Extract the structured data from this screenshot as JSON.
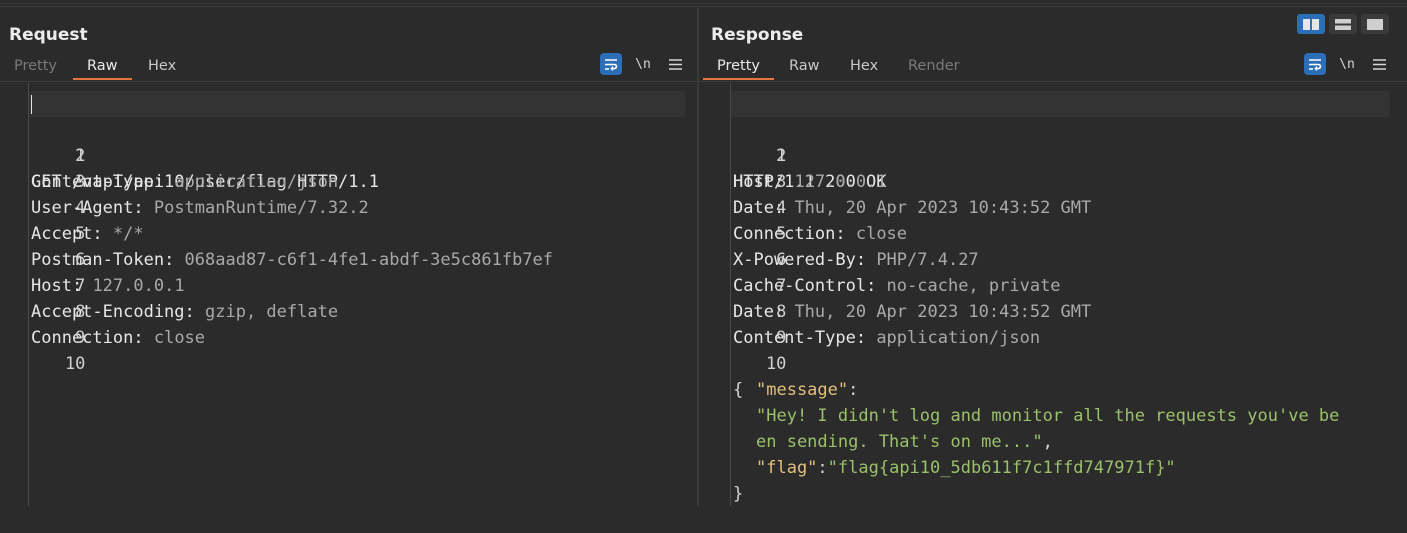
{
  "request": {
    "title": "Request",
    "tabs": [
      "Pretty",
      "Raw",
      "Hex"
    ],
    "active_tab": "Raw",
    "lines": [
      {
        "n": "1",
        "key": "GET /vapi/api10/user/flag HTTP/1.1",
        "val": ""
      },
      {
        "n": "2",
        "key": "Content-Type",
        "val": "application/json"
      },
      {
        "n": "3",
        "key": "User-Agent",
        "val": "PostmanRuntime/7.32.2"
      },
      {
        "n": "4",
        "key": "Accept",
        "val": "*/*"
      },
      {
        "n": "5",
        "key": "Postman-Token",
        "val": "068aad87-c6f1-4fe1-abdf-3e5c861fb7ef"
      },
      {
        "n": "6",
        "key": "Host",
        "val": "127.0.0.1"
      },
      {
        "n": "7",
        "key": "Accept-Encoding",
        "val": "gzip, deflate"
      },
      {
        "n": "8",
        "key": "Connection",
        "val": "close"
      },
      {
        "n": "9",
        "key": "",
        "val": ""
      },
      {
        "n": "10",
        "key": "",
        "val": ""
      }
    ]
  },
  "response": {
    "title": "Response",
    "tabs": [
      "Pretty",
      "Raw",
      "Hex",
      "Render"
    ],
    "active_tab": "Pretty",
    "status_line": "HTTP/1.1 200 OK",
    "headers": [
      {
        "n": "2",
        "key": "Host",
        "val": "127.0.0.1"
      },
      {
        "n": "3",
        "key": "Date",
        "val": "Thu, 20 Apr 2023 10:43:52 GMT"
      },
      {
        "n": "4",
        "key": "Connection",
        "val": "close"
      },
      {
        "n": "5",
        "key": "X-Powered-By",
        "val": "PHP/7.4.27"
      },
      {
        "n": "6",
        "key": "Cache-Control",
        "val": "no-cache, private"
      },
      {
        "n": "7",
        "key": "Date",
        "val": "Thu, 20 Apr 2023 10:43:52 GMT"
      },
      {
        "n": "8",
        "key": "Content-Type",
        "val": "application/json"
      }
    ],
    "body": {
      "open_brace": "{",
      "close_brace": "}",
      "message_key": "\"message\"",
      "message_line1": "\"Hey! I didn't log and monitor all the requests you've be",
      "message_line2": "en sending. That's on me...\"",
      "flag_key": "\"flag\"",
      "flag_value": "\"flag{api10_5db611f7c1ffd747971f}\""
    }
  },
  "toolbar": {
    "wrap_icon": "wrap-lines-icon",
    "newline_label": "\\n",
    "menu_icon": "hamburger-menu-icon"
  },
  "colors": {
    "accent": "#2c6fb7",
    "tab_underline": "#e8733c",
    "json_key": "#e3c07b",
    "json_string": "#9bc16a"
  }
}
